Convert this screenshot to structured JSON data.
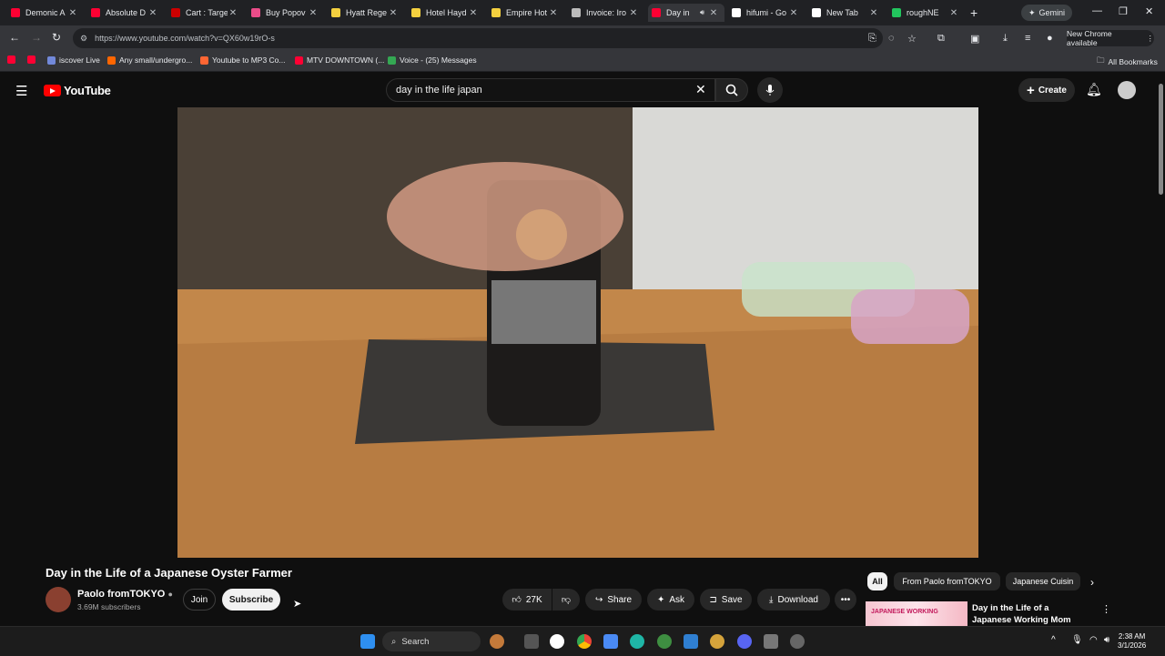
{
  "browser": {
    "tabs": [
      {
        "label": "Demonic A",
        "color": "#ff0033",
        "active": false
      },
      {
        "label": "Absolute D",
        "color": "#ff0033",
        "active": false
      },
      {
        "label": "Cart : Targe",
        "color": "#cc0000",
        "active": false
      },
      {
        "label": "Buy Popov",
        "color": "#ea4c89",
        "active": false
      },
      {
        "label": "Hyatt Rege",
        "color": "#f4d03f",
        "active": false
      },
      {
        "label": "Hotel Hayd",
        "color": "#f4d03f",
        "active": false
      },
      {
        "label": "Empire Hot",
        "color": "#f4d03f",
        "active": false
      },
      {
        "label": "Invoice: Iro",
        "color": "#bbbbbb",
        "active": false
      },
      {
        "label": "Day in",
        "color": "#ff0033",
        "active": true
      },
      {
        "label": "hifumi - Go",
        "color": "#ffffff",
        "active": false
      },
      {
        "label": "New Tab",
        "color": "#ffffff",
        "active": false
      },
      {
        "label": "roughNE",
        "color": "#22c55e",
        "active": false
      }
    ],
    "gemini_label": "Gemini",
    "url": "https://www.youtube.com/watch?v=QX60w19rO-s",
    "chrome_available_label": "New Chrome available",
    "bookmarks": [
      {
        "label": "",
        "color": "#ff0033"
      },
      {
        "label": "",
        "color": "#ff0033"
      },
      {
        "label": "iscover Live",
        "color": "#7289da"
      },
      {
        "label": "Any small/undergro...",
        "color": "#ff6600"
      },
      {
        "label": "Youtube to MP3 Co...",
        "color": "#ff6633"
      },
      {
        "label": "MTV DOWNTOWN (...",
        "color": "#ff0033"
      },
      {
        "label": "Voice - (25) Messages",
        "color": "#34a853"
      }
    ],
    "all_bookmarks_label": "All Bookmarks"
  },
  "youtube": {
    "logo_text": "YouTube",
    "search_value": "day in the life japan",
    "create_label": "Create",
    "video_title": "Day in the Life of a Japanese Oyster Farmer",
    "channel_name": "Paolo fromTOKYO",
    "subscribers": "3.69M subscribers",
    "join_label": "Join",
    "subscribe_label": "Subscribe",
    "like_count": "27K",
    "share_label": "Share",
    "ask_label": "Ask",
    "save_label": "Save",
    "download_label": "Download",
    "chips": [
      "All",
      "From Paolo fromTOKYO",
      "Japanese Cuisin"
    ],
    "reco_title": "Day in the Life of a Japanese Working Mom",
    "reco_thumb_text": "JAPANESE WORKING"
  },
  "taskbar": {
    "search_placeholder": "Search",
    "time": "2:38 AM",
    "date": "3/1/2026"
  }
}
